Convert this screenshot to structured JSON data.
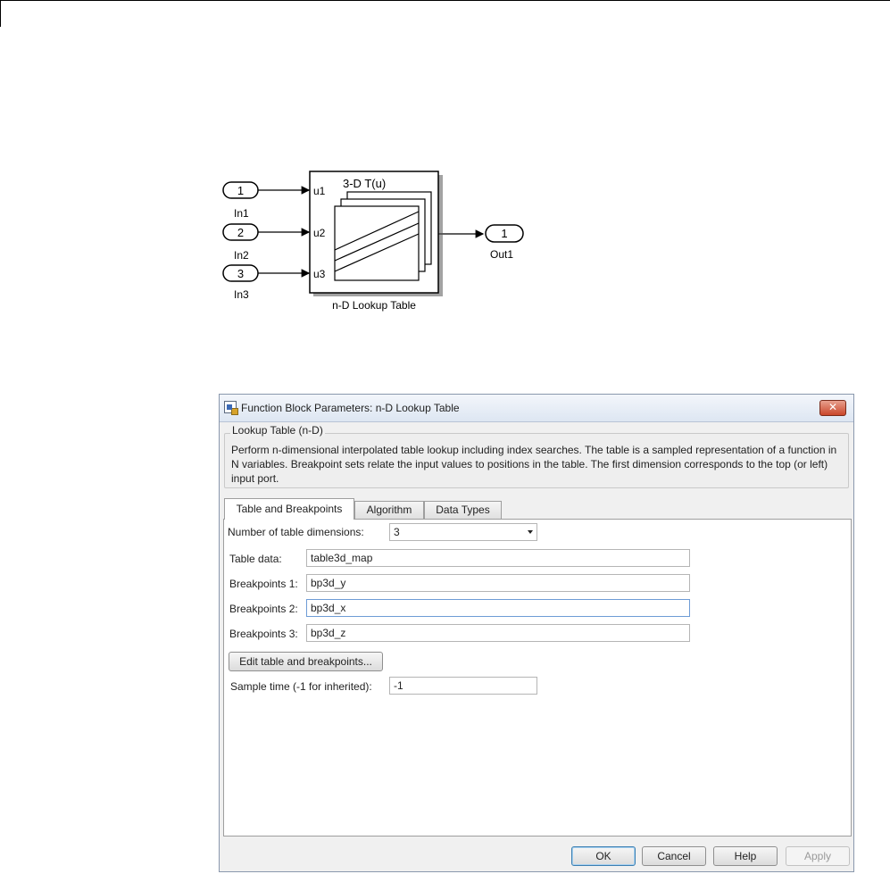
{
  "diagram": {
    "inports": [
      {
        "number": "1",
        "label": "In1"
      },
      {
        "number": "2",
        "label": "In2"
      },
      {
        "number": "3",
        "label": "In3"
      }
    ],
    "block_title": "3-D T(u)",
    "block_ports": [
      "u1",
      "u2",
      "u3"
    ],
    "block_name": "n-D Lookup Table",
    "outport": {
      "number": "1",
      "label": "Out1"
    }
  },
  "dialog": {
    "title": "Function Block Parameters: n-D Lookup Table",
    "close_glyph": "✕",
    "group_title": "Lookup Table (n-D)",
    "description": "Perform n-dimensional interpolated table lookup including index searches. The table is a sampled representation of a function in N variables. Breakpoint sets relate the input values to positions in the table. The first dimension corresponds to the top (or left) input port.",
    "tabs": [
      "Table and Breakpoints",
      "Algorithm",
      "Data Types"
    ],
    "num_dims_label": "Number of table dimensions:",
    "num_dims_value": "3",
    "table_data_label": "Table data:",
    "table_data_value": "table3d_map",
    "bp1_label": "Breakpoints 1:",
    "bp1_value": "bp3d_y",
    "bp2_label": "Breakpoints 2:",
    "bp2_value": "bp3d_x",
    "bp3_label": "Breakpoints 3:",
    "bp3_value": "bp3d_z",
    "edit_button": "Edit table and breakpoints...",
    "sample_time_label": "Sample time (-1 for inherited):",
    "sample_time_value": "-1",
    "buttons": {
      "ok": "OK",
      "cancel": "Cancel",
      "help": "Help",
      "apply": "Apply"
    }
  },
  "colors": {
    "accent": "#3c7fb1",
    "close": "#c9462a"
  },
  "icons": {
    "window": "simulink-block-icon",
    "close": "close-icon",
    "dropdown": "chevron-down-icon"
  }
}
